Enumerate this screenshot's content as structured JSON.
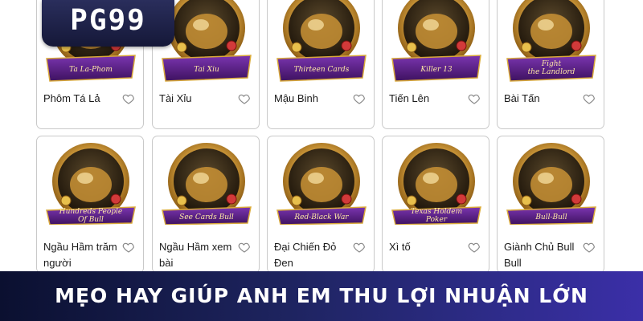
{
  "brand": {
    "logo_text": "PG99"
  },
  "games": [
    {
      "name": "Phôm Tá Lả",
      "art_label": "Ta La-Phom",
      "art_label2": "",
      "art_icon": "ta-la-phom-art-icon"
    },
    {
      "name": "Tài Xỉu",
      "art_label": "Tai Xiu",
      "art_label2": "",
      "art_icon": "dice-cup-icon"
    },
    {
      "name": "Mậu Binh",
      "art_label": "Thirteen Cards",
      "art_label2": "",
      "art_icon": "revolver-icon"
    },
    {
      "name": "Tiến Lên",
      "art_label": "Killer 13",
      "art_label2": "",
      "art_icon": "bomb-icon"
    },
    {
      "name": "Bài Tấn",
      "art_label": "Fight",
      "art_label2": "the Landlord",
      "art_icon": "landlord-icon"
    },
    {
      "name": "Ngầu Hầm trăm người",
      "art_label": "Hundreds People",
      "art_label2": "Of Bull",
      "art_icon": "bull-horns-icon"
    },
    {
      "name": "Ngầu Hầm xem bài",
      "art_label": "See Cards Bull",
      "art_label2": "",
      "art_icon": "bull-mascot-icon"
    },
    {
      "name": "Đại Chiến Đỏ Đen",
      "art_label": "Red-Black War",
      "art_label2": "",
      "art_icon": "vs-cards-icon"
    },
    {
      "name": "Xì tố",
      "art_label": "Texas Holdem",
      "art_label2": "Poker",
      "art_icon": "crown-icon"
    },
    {
      "name": "Giành Chủ Bull Bull",
      "art_label": "Bull-Bull",
      "art_label2": "",
      "art_icon": "bull-head-icon"
    }
  ],
  "banner": {
    "text": "MẸO HAY GIÚP ANH EM THU LỢI NHUẬN LỚN"
  },
  "colors": {
    "gold": "#c8921e",
    "gold_light": "#f3d27a",
    "ribbon": "#5a1f86",
    "banner_dark": "#0b1030",
    "banner_light": "#3b2fa8"
  }
}
